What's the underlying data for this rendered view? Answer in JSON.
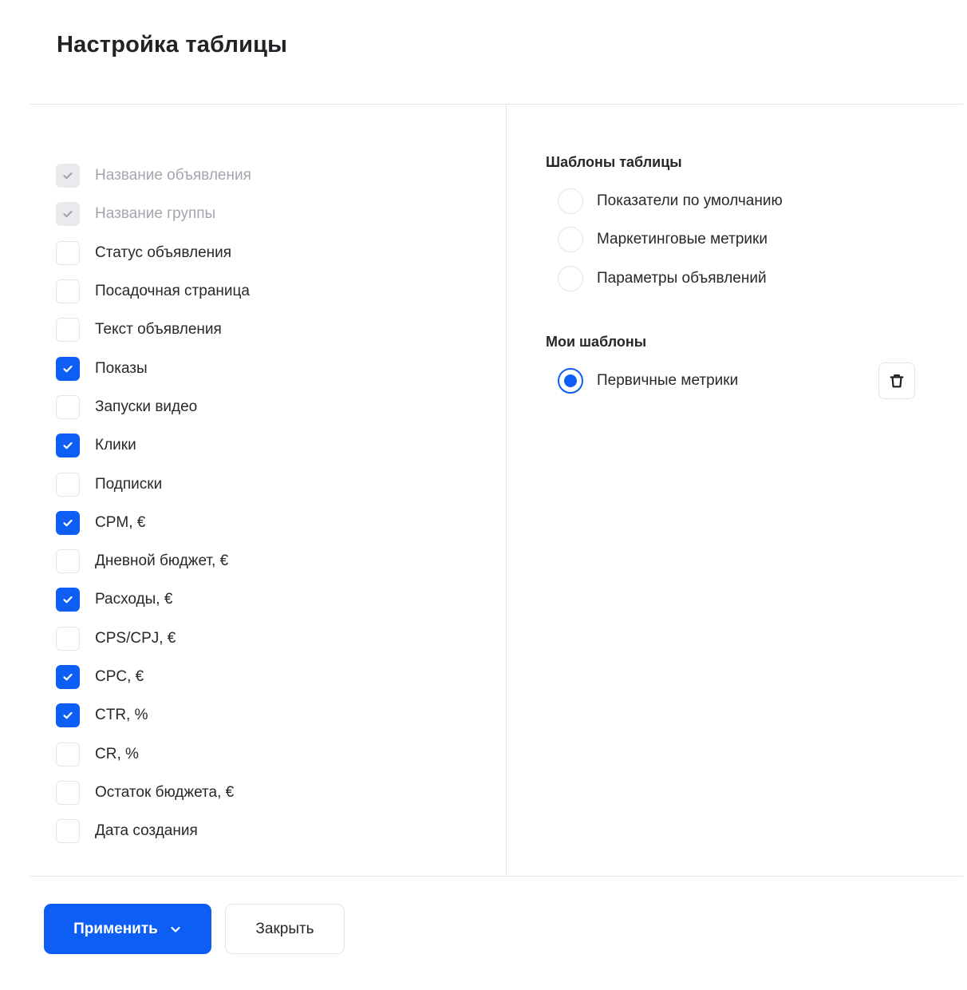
{
  "dialog": {
    "title": "Настройка таблицы"
  },
  "columns": [
    {
      "label": "Название объявления",
      "checked": true,
      "disabled": true
    },
    {
      "label": "Название группы",
      "checked": true,
      "disabled": true
    },
    {
      "label": "Статус объявления",
      "checked": false,
      "disabled": false
    },
    {
      "label": "Посадочная страница",
      "checked": false,
      "disabled": false
    },
    {
      "label": "Текст объявления",
      "checked": false,
      "disabled": false
    },
    {
      "label": "Показы",
      "checked": true,
      "disabled": false
    },
    {
      "label": "Запуски видео",
      "checked": false,
      "disabled": false
    },
    {
      "label": "Клики",
      "checked": true,
      "disabled": false
    },
    {
      "label": "Подписки",
      "checked": false,
      "disabled": false
    },
    {
      "label": "CPM, €",
      "checked": true,
      "disabled": false
    },
    {
      "label": "Дневной бюджет, €",
      "checked": false,
      "disabled": false
    },
    {
      "label": "Расходы, €",
      "checked": true,
      "disabled": false
    },
    {
      "label": "CPS/CPJ, €",
      "checked": false,
      "disabled": false
    },
    {
      "label": "CPC, €",
      "checked": true,
      "disabled": false
    },
    {
      "label": "CTR, %",
      "checked": true,
      "disabled": false
    },
    {
      "label": "CR, %",
      "checked": false,
      "disabled": false
    },
    {
      "label": "Остаток бюджета, €",
      "checked": false,
      "disabled": false
    },
    {
      "label": "Дата создания",
      "checked": false,
      "disabled": false
    }
  ],
  "templates": {
    "title": "Шаблоны таблицы",
    "options": [
      {
        "label": "Показатели по умолчанию",
        "selected": false
      },
      {
        "label": "Маркетинговые метрики",
        "selected": false
      },
      {
        "label": "Параметры объявлений",
        "selected": false
      }
    ]
  },
  "my_templates": {
    "title": "Мои шаблоны",
    "options": [
      {
        "label": "Первичные метрики",
        "selected": true
      }
    ],
    "delete_icon": "trash-icon"
  },
  "footer": {
    "apply_label": "Применить",
    "close_label": "Закрыть"
  },
  "colors": {
    "accent": "#0d5ef4",
    "divider": "#e4e6eb",
    "disabled_text": "#a3a6ae"
  }
}
